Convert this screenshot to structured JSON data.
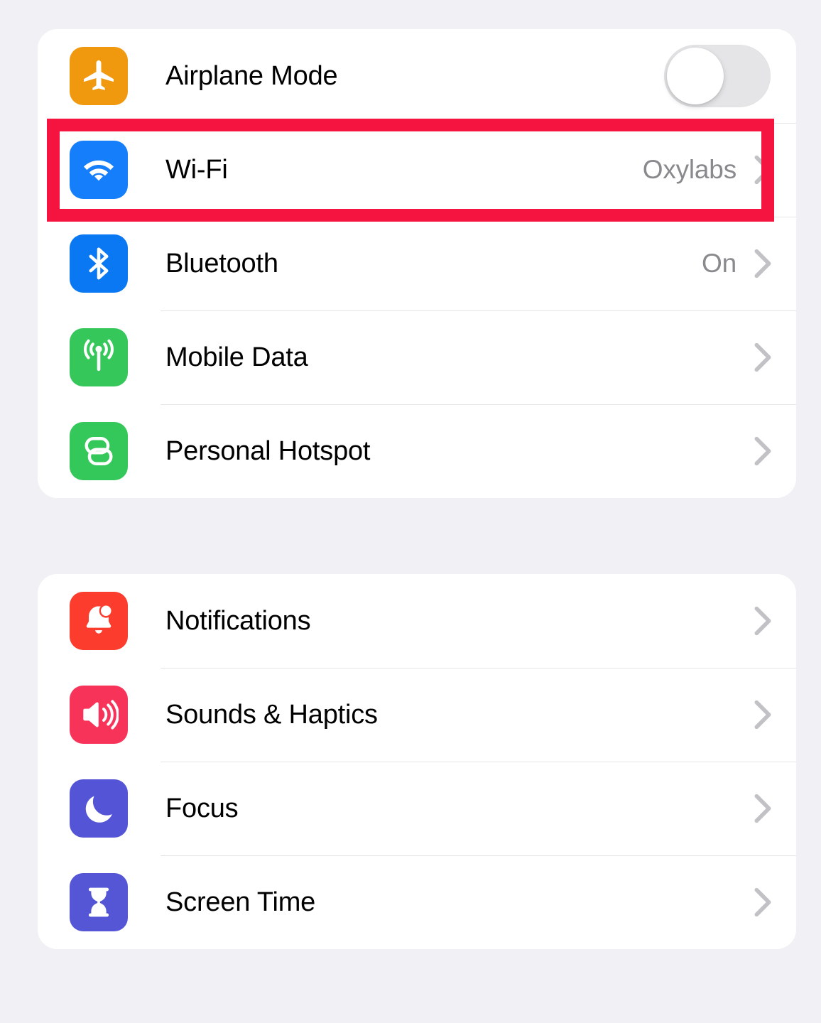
{
  "theme": {
    "background": "#f1f1f5",
    "card_background": "#ffffff",
    "label_color": "#000000",
    "value_color": "#8a8a8e",
    "separator_color": "#e6e6e8",
    "chevron_color": "#c2c2c6",
    "highlight_color": "#f5143f",
    "toggle_off_track": "#e5e5e7",
    "toggle_knob": "#ffffff"
  },
  "highlight": {
    "target": "Wi-Fi",
    "label": "wifi-row-highlight"
  },
  "groups": [
    {
      "name": "connectivity",
      "rows": [
        {
          "id": "airplane-mode",
          "label": "Airplane Mode",
          "icon": "airplane-icon",
          "icon_color": "#f0990f",
          "control": "toggle",
          "toggle_on": false,
          "value": "",
          "chevron": false
        },
        {
          "id": "wifi",
          "label": "Wi-Fi",
          "icon": "wifi-icon",
          "icon_color": "#157efb",
          "control": "disclosure",
          "value": "Oxylabs",
          "chevron": true
        },
        {
          "id": "bluetooth",
          "label": "Bluetooth",
          "icon": "bluetooth-icon",
          "icon_color": "#0a78f3",
          "control": "disclosure",
          "value": "On",
          "chevron": true
        },
        {
          "id": "mobile-data",
          "label": "Mobile Data",
          "icon": "antenna-icon",
          "icon_color": "#35c759",
          "control": "disclosure",
          "value": "",
          "chevron": true
        },
        {
          "id": "personal-hotspot",
          "label": "Personal Hotspot",
          "icon": "hotspot-link-icon",
          "icon_color": "#34c759",
          "control": "disclosure",
          "value": "",
          "chevron": true
        }
      ]
    },
    {
      "name": "system",
      "rows": [
        {
          "id": "notifications",
          "label": "Notifications",
          "icon": "bell-icon",
          "icon_color": "#fc3c2d",
          "control": "disclosure",
          "value": "",
          "chevron": true
        },
        {
          "id": "sounds-haptics",
          "label": "Sounds & Haptics",
          "icon": "speaker-icon",
          "icon_color": "#f8335a",
          "control": "disclosure",
          "value": "",
          "chevron": true
        },
        {
          "id": "focus",
          "label": "Focus",
          "icon": "moon-icon",
          "icon_color": "#5455d6",
          "control": "disclosure",
          "value": "",
          "chevron": true
        },
        {
          "id": "screen-time",
          "label": "Screen Time",
          "icon": "hourglass-icon",
          "icon_color": "#5456d6",
          "control": "disclosure",
          "value": "",
          "chevron": true
        }
      ]
    }
  ]
}
